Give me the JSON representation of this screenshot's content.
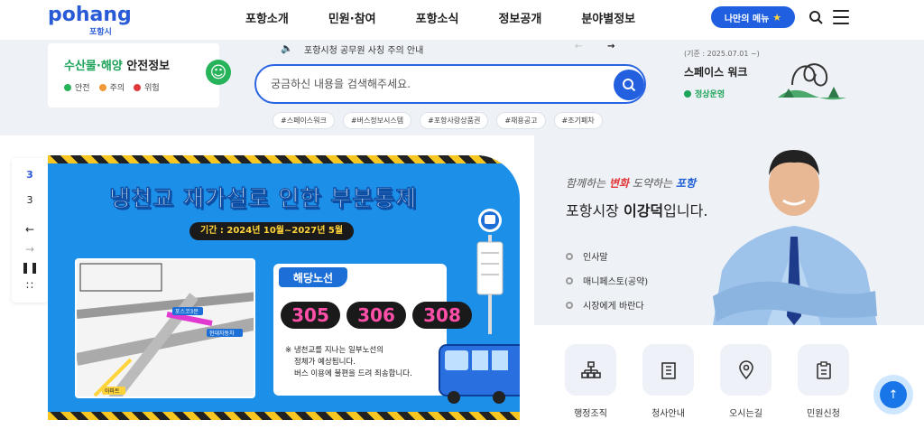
{
  "header": {
    "logo_text": "pohang",
    "logo_sub": "포항시",
    "nav": [
      "포항소개",
      "민원·참여",
      "포항소식",
      "정보공개",
      "분야별정보"
    ],
    "my_menu_label": "나만의 메뉴",
    "accent_color": "#1f5fe0"
  },
  "safety": {
    "title_green": "수산물·해양",
    "title_dark": "안전정보",
    "legend": [
      {
        "label": "안전",
        "color": "#27b35a"
      },
      {
        "label": "주의",
        "color": "#f29a3a"
      },
      {
        "label": "위험",
        "color": "#e23a3a"
      }
    ]
  },
  "notice": {
    "text": "포항시청 공무원 사칭 주의 안내",
    "prev": "←",
    "next": "→"
  },
  "search": {
    "placeholder": "궁금하신 내용을 검색해주세요.",
    "tags": [
      "#스페이스워크",
      "#버스정보시스템",
      "#포항사랑상품권",
      "#채용공고",
      "#조기폐차"
    ]
  },
  "space_walk": {
    "since": "(기준 : 2025.07.01 ~)",
    "title": "스페이스 워크",
    "status": "정상운영"
  },
  "pager": {
    "current": "3",
    "total": "3"
  },
  "banner": {
    "title": "냉천교 재가설로 인한 부분통제",
    "period": "기간 : 2024년 10월~2027년 5월",
    "route_label": "해당노선",
    "routes": [
      "305",
      "306",
      "308"
    ],
    "note_lines": [
      "※ 냉천교를 지나는 일부노선의",
      "정체가 예상됩니다.",
      "버스 이용에 불편을 드려 죄송합니다."
    ],
    "map_labels": [
      "포스코3문",
      "현대자동차",
      "아파트"
    ]
  },
  "mayor": {
    "slogan_pre": "함께하는",
    "slogan_red": "변화",
    "slogan_mid": "도약하는",
    "slogan_blue": "포항",
    "name_pre": "포항시장",
    "name_bold": "이강덕",
    "name_post": "입니다.",
    "links": [
      "인사말",
      "매니페스토(공약)",
      "시장에게 바란다"
    ]
  },
  "quick": [
    {
      "label": "행정조직",
      "icon": "org-chart-icon"
    },
    {
      "label": "청사안내",
      "icon": "building-icon"
    },
    {
      "label": "오시는길",
      "icon": "map-pin-icon"
    },
    {
      "label": "민원신청",
      "icon": "clipboard-icon"
    }
  ]
}
